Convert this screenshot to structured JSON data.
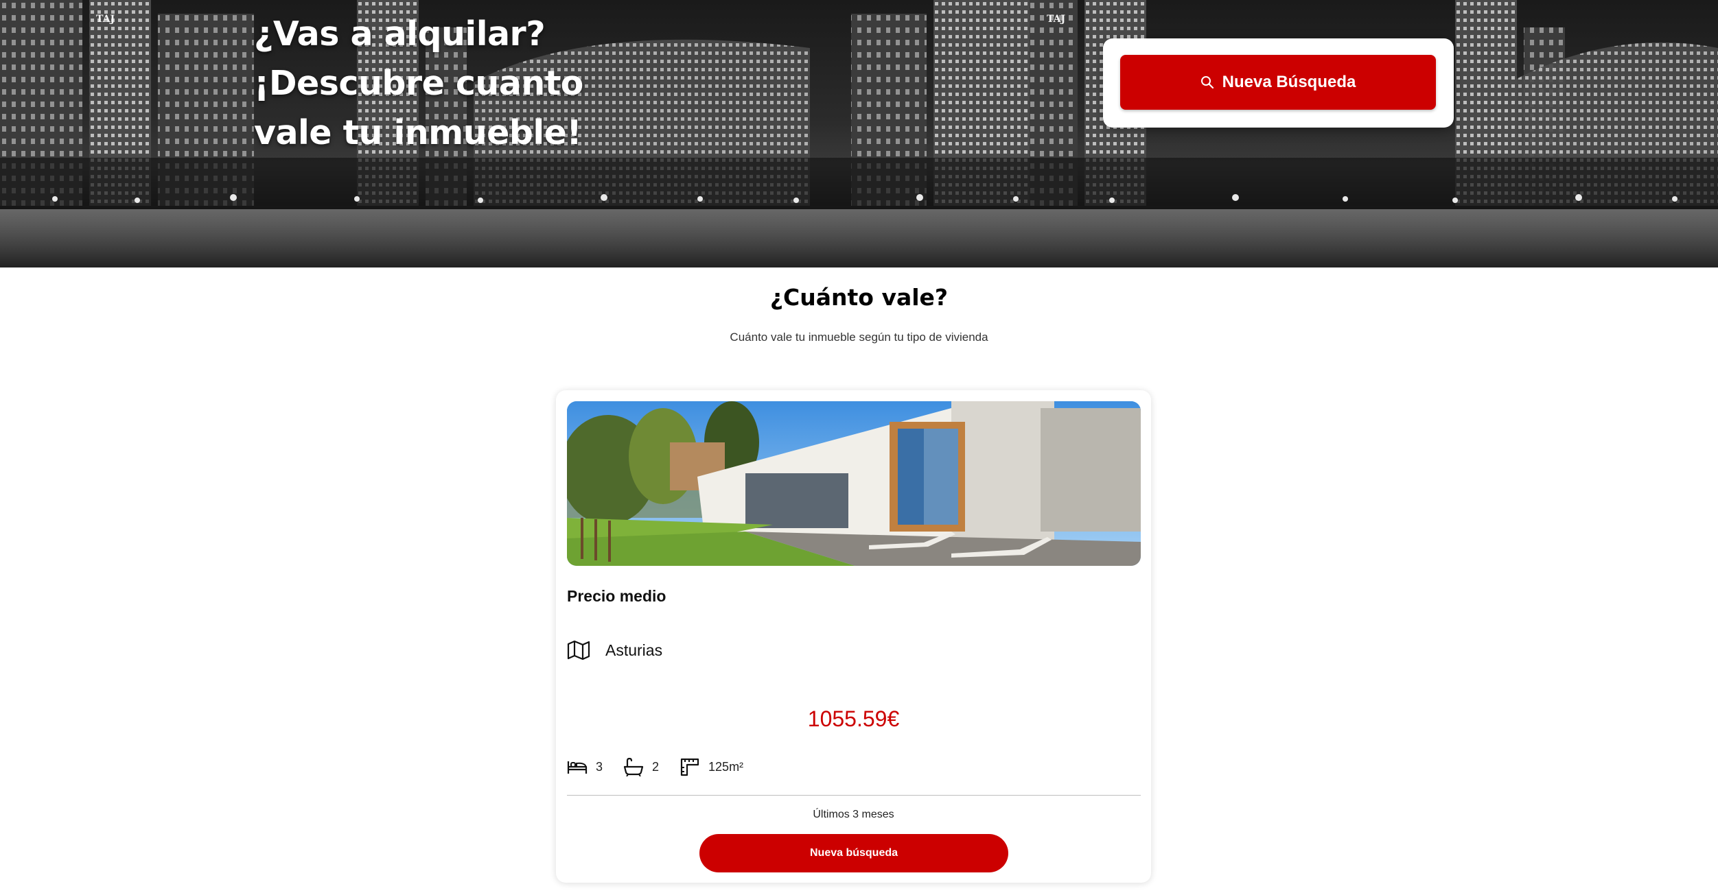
{
  "hero": {
    "title_lines": [
      "¿Vas a alquilar?",
      "¡Descubre cuanto",
      "vale tu inmueble!"
    ],
    "search_button_label": "Nueva Búsqueda",
    "search_icon": "search-icon",
    "background": "night-city-skyline-grayscale",
    "building_sign": "TAJ"
  },
  "section": {
    "title": "¿Cuánto vale?",
    "subtitle": "Cuánto vale tu inmueble según tu tipo de vivienda"
  },
  "card": {
    "photo": "modern-house-photo",
    "label": "Precio medio",
    "location_icon": "map-icon",
    "location": "Asturias",
    "price": "1055.59€",
    "features": [
      {
        "icon": "bed-icon",
        "value": "3"
      },
      {
        "icon": "bath-icon",
        "value": "2"
      },
      {
        "icon": "area-icon",
        "value": "125m²"
      }
    ],
    "period": "Últimos 3 meses",
    "button_label": "Nueva búsqueda"
  },
  "colors": {
    "accent": "#cc0000",
    "text": "#111111",
    "background": "#ffffff"
  }
}
